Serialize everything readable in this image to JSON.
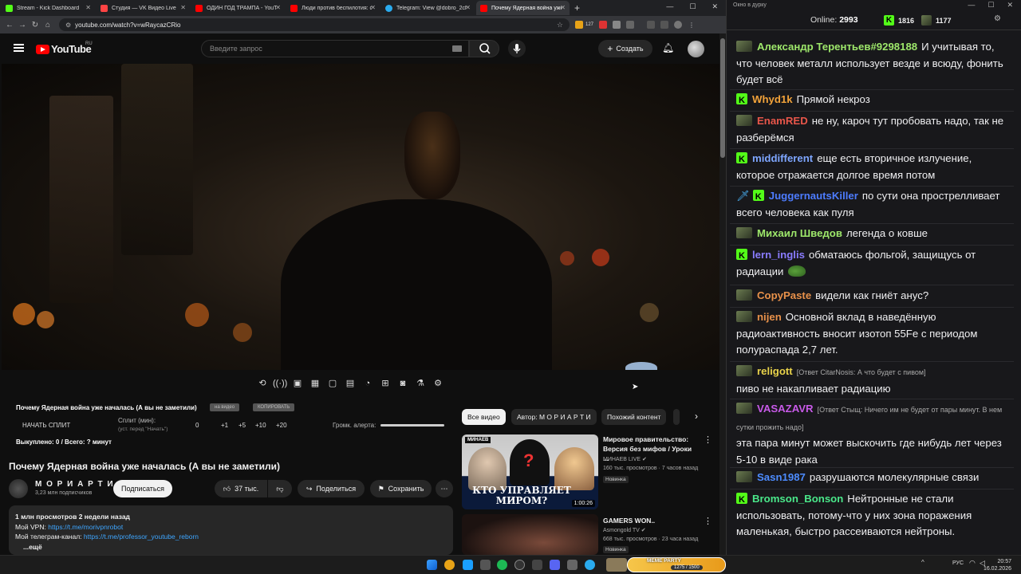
{
  "browser": {
    "tabs": [
      {
        "label": "Stream - Kick Dashboard",
        "color": "#53fc18"
      },
      {
        "label": "Студия — VK Видео Live",
        "color": "#ff4444"
      },
      {
        "label": "ОДИН ГОД ТРАМПА - YouTub...",
        "color": "#ff0000"
      },
      {
        "label": "Люди против беспилотия: сем...",
        "color": "#ff0000"
      },
      {
        "label": "Telegram: View @dobro_2ch",
        "color": "#2aabee"
      },
      {
        "label": "Почему Ядерная война уже н...",
        "color": "#ff0000"
      }
    ],
    "url": "youtube.com/watch?v=wRaycazCRio",
    "ext_count": "127"
  },
  "youtube": {
    "logo_text": "YouTube",
    "region": "RU",
    "search_placeholder": "Введите запрос",
    "create_label": "Создать",
    "toolbar_icons": [
      "loop-icon",
      "broadcast-icon",
      "screen-record-icon",
      "calendar-icon",
      "picture-icon",
      "clip-icon",
      "speed-icon",
      "add-icon",
      "camera-icon",
      "flask-icon",
      "settings-icon"
    ],
    "ext": {
      "title": "Почему Ядерная война уже началась (А вы не заметили)",
      "chip1": "на видео",
      "chip2": "КОПИРОВАТЬ",
      "split_start": "НАЧАТЬ СПЛИТ",
      "split_label": "Сплит (мин):",
      "split_sub": "(уст. перед \"Начать\")",
      "split_values": [
        "0",
        "+1",
        "+5",
        "+10",
        "+20"
      ],
      "alert_label": "Громк. алерта:",
      "paid_text": "Выкуплено: 0 / Всего: ? минут"
    },
    "video_title": "Почему Ядерная война уже началась (А вы не заметили)",
    "channel": {
      "name": "М О Р И А Р Т И",
      "subs": "3,23 млн подписчиков",
      "subscribe_label": "Подписаться"
    },
    "actions": {
      "likes": "37 тыс.",
      "share": "Поделиться",
      "save": "Сохранить"
    },
    "description": {
      "stats": "1 млн просмотров  2 недели назад",
      "vpn_label": "Мой VPN: ",
      "vpn_link": "https://t.me/morivpnrobot",
      "tg_label": "Мой телеграм-канал: ",
      "tg_link": "https://t.me/professor_youtube_reborn",
      "more": "...ещё"
    },
    "filters": [
      "Все видео",
      "Автор: М О Р И А Р Т И",
      "Похожий контент"
    ],
    "related": [
      {
        "title": "Мировое правительство: Версия без мифов / Уроки ...",
        "channel": "МИНАЕВ LIVE",
        "meta": "160 тыс. просмотров · 7 часов назад",
        "badge": "Новинка",
        "duration": "1:00:26",
        "thumb_text": "КТО УПРАВЛЯЕТ МИРОМ?",
        "thumb_tag": "МИНАЕВ"
      },
      {
        "title": "GAMERS WON..",
        "channel": "Asmongold TV",
        "meta": "668 тыс. просмотров · 23 часа назад",
        "badge": "Новинка"
      }
    ]
  },
  "chat": {
    "window_title": "Окно в дурку",
    "online_label": "Online:",
    "online_count": "2993",
    "kick_count": "1816",
    "other_count": "1177",
    "messages": [
      {
        "user": "Александр Терентьев#9298188",
        "color": "#9ee86b",
        "text": "И учитывая то, что человек металл использует везде и всюду, фонить будет всё",
        "badge": "avatar"
      },
      {
        "user": "Whyd1k",
        "color": "#f3a33a",
        "text": "Прямой некроз",
        "badge": "kick"
      },
      {
        "user": "EnamRED",
        "color": "#e8564a",
        "text": "не ну, кароч тут пробовать надо, так не разберёмся",
        "badge": "avatar"
      },
      {
        "user": "middifferent",
        "color": "#7ea6ff",
        "text": "еще есть вторичное излучение, которое отражается долгое время потом",
        "badge": "kick"
      },
      {
        "user": "JuggernautsKiller",
        "color": "#4d7cff",
        "text": "по сути она прострелливает всего человека как пуля",
        "badge": "kick"
      },
      {
        "user": "Михаил Шведов",
        "color": "#9ee86b",
        "text": "легенда о ковше",
        "badge": "avatar"
      },
      {
        "user": "lern_inglis",
        "color": "#8a7cff",
        "text": "обматаюсь фольгой, защищусь от радиации",
        "badge": "kick"
      },
      {
        "user": "CopyPaste",
        "color": "#e8914a",
        "text": "видели как гниёт анус?",
        "badge": "avatar"
      },
      {
        "user": "nijen",
        "color": "#e8914a",
        "text": "Основной вклад в наведённую радиоактивность вносит изотоп 55Fe с периодом полураспада 2,7 лет.",
        "badge": "avatar"
      },
      {
        "user": "religott",
        "color": "#e8d24a",
        "reply": "[Ответ CitarNosis: А что будет с пивом]",
        "text": "пиво не накапливает радиацию",
        "badge": "avatar"
      },
      {
        "user": "VASAZAVR",
        "color": "#c85ae8",
        "reply": "[Ответ Стыщ: Ничего им не будет от пары минут. В нем сутки прожить надо]",
        "text": "эта пара минут может выскочить где нибудь лет через 5-10 в виде рака",
        "badge": "avatar"
      },
      {
        "user": "Sasn1987",
        "color": "#4d8cff",
        "text": "разрушаются молекулярные связи",
        "badge": "avatar"
      },
      {
        "user": "Bromson_Bonson",
        "color": "#4ae88a",
        "text": "Нейтронные не стали использовать, потому-что у них зона поражения маленькая, быстро рассеиваются нейтроны.",
        "badge": "kick"
      }
    ]
  },
  "taskbar": {
    "overlay_label": "MEME PARTY",
    "overlay_value": "1275 / 1500",
    "lang": "РУС",
    "time": "20:57",
    "date": "16.02.2026"
  }
}
